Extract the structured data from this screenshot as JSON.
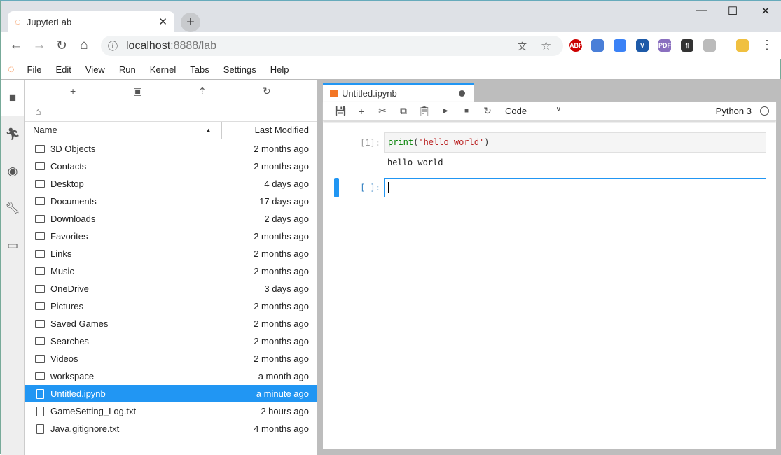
{
  "browser": {
    "tab_title": "JupyterLab",
    "url_host": "localhost",
    "url_port": ":8888/lab",
    "extensions": [
      {
        "name": "abp-icon",
        "label": "ABP",
        "color": "#c00"
      },
      {
        "name": "graduation-icon",
        "label": "",
        "color": "#4a7fd8"
      },
      {
        "name": "pen-icon",
        "label": "",
        "color": "#3b82f6"
      },
      {
        "name": "v-icon",
        "label": "V",
        "color": "#1e5aa8"
      },
      {
        "name": "pdf-icon",
        "label": "PDF",
        "color": "#8a6fbf"
      },
      {
        "name": "pilcrow-icon",
        "label": "¶",
        "color": "#333"
      },
      {
        "name": "shield-icon",
        "label": "",
        "color": "#bbb"
      },
      {
        "name": "weather-icon",
        "label": "",
        "color": "#f0c040"
      }
    ]
  },
  "menu": [
    "File",
    "Edit",
    "View",
    "Run",
    "Kernel",
    "Tabs",
    "Settings",
    "Help"
  ],
  "filebrowser": {
    "col_name": "Name",
    "col_modified": "Last Modified",
    "items": [
      {
        "name": "3D Objects",
        "modified": "2 months ago",
        "type": "folder"
      },
      {
        "name": "Contacts",
        "modified": "2 months ago",
        "type": "folder"
      },
      {
        "name": "Desktop",
        "modified": "4 days ago",
        "type": "folder"
      },
      {
        "name": "Documents",
        "modified": "17 days ago",
        "type": "folder"
      },
      {
        "name": "Downloads",
        "modified": "2 days ago",
        "type": "folder"
      },
      {
        "name": "Favorites",
        "modified": "2 months ago",
        "type": "folder"
      },
      {
        "name": "Links",
        "modified": "2 months ago",
        "type": "folder"
      },
      {
        "name": "Music",
        "modified": "2 months ago",
        "type": "folder"
      },
      {
        "name": "OneDrive",
        "modified": "3 days ago",
        "type": "folder"
      },
      {
        "name": "Pictures",
        "modified": "2 months ago",
        "type": "folder"
      },
      {
        "name": "Saved Games",
        "modified": "2 months ago",
        "type": "folder"
      },
      {
        "name": "Searches",
        "modified": "2 months ago",
        "type": "folder"
      },
      {
        "name": "Videos",
        "modified": "2 months ago",
        "type": "folder"
      },
      {
        "name": "workspace",
        "modified": "a month ago",
        "type": "folder"
      },
      {
        "name": "Untitled.ipynb",
        "modified": "a minute ago",
        "type": "notebook",
        "selected": true
      },
      {
        "name": "GameSetting_Log.txt",
        "modified": "2 hours ago",
        "type": "file"
      },
      {
        "name": "Java.gitignore.txt",
        "modified": "4 months ago",
        "type": "file"
      }
    ]
  },
  "notebook": {
    "tab_title": "Untitled.ipynb",
    "cell_type": "Code",
    "kernel": "Python 3",
    "cells": [
      {
        "prompt": "[1]:",
        "code_fn": "print",
        "code_open": "(",
        "code_str": "'hello world'",
        "code_close": ")",
        "output": "hello world"
      },
      {
        "prompt": "[ ]:",
        "code": ""
      }
    ]
  },
  "colors": {
    "accent": "#2196f3",
    "jupyter_orange": "#f37626"
  }
}
